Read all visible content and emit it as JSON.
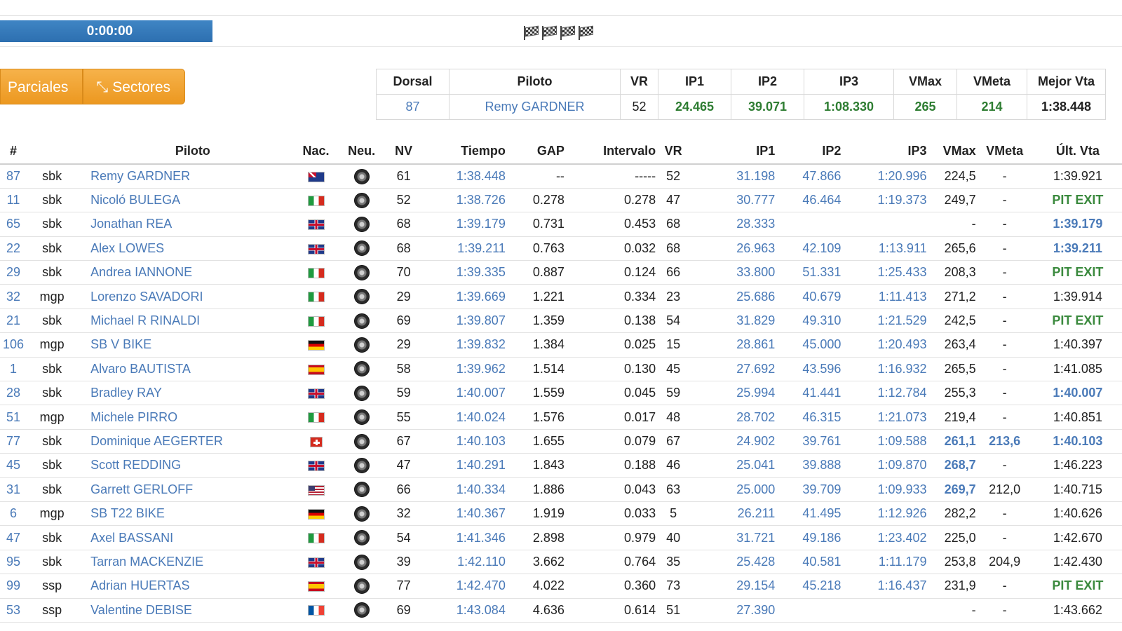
{
  "timer": "0:00:00",
  "buttons": {
    "parciales": "Parciales",
    "sectores": "Sectores"
  },
  "best": {
    "headers": [
      "Dorsal",
      "Piloto",
      "VR",
      "IP1",
      "IP2",
      "IP3",
      "VMax",
      "VMeta",
      "Mejor Vta"
    ],
    "row": [
      "87",
      "Remy GARDNER",
      "52",
      "24.465",
      "39.071",
      "1:08.330",
      "265",
      "214",
      "1:38.448"
    ]
  },
  "table": {
    "headers": [
      "#",
      "",
      "Piloto",
      "Nac.",
      "Neu.",
      "NV",
      "Tiempo",
      "GAP",
      "Intervalo",
      "VR",
      "IP1",
      "IP2",
      "IP3",
      "VMax",
      "VMeta",
      "Últ. Vta"
    ],
    "rows": [
      {
        "num": "87",
        "cls": "sbk",
        "piloto": "Remy GARDNER",
        "nac": "AUS",
        "nv": "61",
        "tiempo": "1:38.448",
        "gap": "--",
        "int": "-----",
        "vr": "52",
        "ip1": "31.198",
        "ip2": "47.866",
        "ip3": "1:20.996",
        "vmax": "224,5",
        "vmeta": "-",
        "ult": "1:39.921"
      },
      {
        "num": "11",
        "cls": "sbk",
        "piloto": "Nicoló BULEGA",
        "nac": "ITA",
        "nv": "52",
        "tiempo": "1:38.726",
        "gap": "0.278",
        "int": "0.278",
        "vr": "47",
        "ip1": "30.777",
        "ip2": "46.464",
        "ip3": "1:19.373",
        "vmax": "249,7",
        "vmeta": "-",
        "ult": "PIT EXIT",
        "ult_style": "green"
      },
      {
        "num": "65",
        "cls": "sbk",
        "piloto": "Jonathan REA",
        "nac": "GBR",
        "nv": "68",
        "tiempo": "1:39.179",
        "gap": "0.731",
        "int": "0.453",
        "vr": "68",
        "ip1": "28.333",
        "ip2": "",
        "ip3": "",
        "vmax": "-",
        "vmeta": "-",
        "ult": "1:39.179",
        "ult_style": "blue"
      },
      {
        "num": "22",
        "cls": "sbk",
        "piloto": "Alex LOWES",
        "nac": "GBR",
        "nv": "68",
        "tiempo": "1:39.211",
        "gap": "0.763",
        "int": "0.032",
        "vr": "68",
        "ip1": "26.963",
        "ip2": "42.109",
        "ip3": "1:13.911",
        "vmax": "265,6",
        "vmeta": "-",
        "ult": "1:39.211",
        "ult_style": "blue"
      },
      {
        "num": "29",
        "cls": "sbk",
        "piloto": "Andrea IANNONE",
        "nac": "ITA",
        "nv": "70",
        "tiempo": "1:39.335",
        "gap": "0.887",
        "int": "0.124",
        "vr": "66",
        "ip1": "33.800",
        "ip2": "51.331",
        "ip3": "1:25.433",
        "vmax": "208,3",
        "vmeta": "-",
        "ult": "PIT EXIT",
        "ult_style": "green"
      },
      {
        "num": "32",
        "cls": "mgp",
        "piloto": "Lorenzo SAVADORI",
        "nac": "ITA",
        "nv": "29",
        "tiempo": "1:39.669",
        "gap": "1.221",
        "int": "0.334",
        "vr": "23",
        "ip1": "25.686",
        "ip2": "40.679",
        "ip3": "1:11.413",
        "vmax": "271,2",
        "vmeta": "-",
        "ult": "1:39.914"
      },
      {
        "num": "21",
        "cls": "sbk",
        "piloto": "Michael R RINALDI",
        "nac": "ITA",
        "nv": "69",
        "tiempo": "1:39.807",
        "gap": "1.359",
        "int": "0.138",
        "vr": "54",
        "ip1": "31.829",
        "ip2": "49.310",
        "ip3": "1:21.529",
        "vmax": "242,5",
        "vmeta": "-",
        "ult": "PIT EXIT",
        "ult_style": "green"
      },
      {
        "num": "106",
        "cls": "mgp",
        "piloto": "SB V BIKE",
        "nac": "DEU",
        "nv": "29",
        "tiempo": "1:39.832",
        "gap": "1.384",
        "int": "0.025",
        "vr": "15",
        "ip1": "28.861",
        "ip2": "45.000",
        "ip3": "1:20.493",
        "vmax": "263,4",
        "vmeta": "-",
        "ult": "1:40.397"
      },
      {
        "num": "1",
        "cls": "sbk",
        "piloto": "Alvaro BAUTISTA",
        "nac": "ESP",
        "nv": "58",
        "tiempo": "1:39.962",
        "gap": "1.514",
        "int": "0.130",
        "vr": "45",
        "ip1": "27.692",
        "ip2": "43.596",
        "ip3": "1:16.932",
        "vmax": "265,5",
        "vmeta": "-",
        "ult": "1:41.085"
      },
      {
        "num": "28",
        "cls": "sbk",
        "piloto": "Bradley RAY",
        "nac": "GBR",
        "nv": "59",
        "tiempo": "1:40.007",
        "gap": "1.559",
        "int": "0.045",
        "vr": "59",
        "ip1": "25.994",
        "ip2": "41.441",
        "ip3": "1:12.784",
        "vmax": "255,3",
        "vmeta": "-",
        "ult": "1:40.007",
        "ult_style": "blue"
      },
      {
        "num": "51",
        "cls": "mgp",
        "piloto": "Michele PIRRO",
        "nac": "ITA",
        "nv": "55",
        "tiempo": "1:40.024",
        "gap": "1.576",
        "int": "0.017",
        "vr": "48",
        "ip1": "28.702",
        "ip2": "46.315",
        "ip3": "1:21.073",
        "vmax": "219,4",
        "vmeta": "-",
        "ult": "1:40.851"
      },
      {
        "num": "77",
        "cls": "sbk",
        "piloto": "Dominique AEGERTER",
        "nac": "CHE",
        "nv": "67",
        "tiempo": "1:40.103",
        "gap": "1.655",
        "int": "0.079",
        "vr": "67",
        "ip1": "24.902",
        "ip2": "39.761",
        "ip3": "1:09.588",
        "vmax": "261,1",
        "vmax_style": "blue",
        "vmeta": "213,6",
        "vmeta_style": "blue",
        "ult": "1:40.103",
        "ult_style": "blue"
      },
      {
        "num": "45",
        "cls": "sbk",
        "piloto": "Scott REDDING",
        "nac": "GBR",
        "nv": "47",
        "tiempo": "1:40.291",
        "gap": "1.843",
        "int": "0.188",
        "vr": "46",
        "ip1": "25.041",
        "ip2": "39.888",
        "ip3": "1:09.870",
        "vmax": "268,7",
        "vmax_style": "blue",
        "vmeta": "-",
        "ult": "1:46.223"
      },
      {
        "num": "31",
        "cls": "sbk",
        "piloto": "Garrett GERLOFF",
        "nac": "USA",
        "nv": "66",
        "tiempo": "1:40.334",
        "gap": "1.886",
        "int": "0.043",
        "vr": "63",
        "ip1": "25.000",
        "ip2": "39.709",
        "ip3": "1:09.933",
        "vmax": "269,7",
        "vmax_style": "blue",
        "vmeta": "212,0",
        "ult": "1:40.715"
      },
      {
        "num": "6",
        "cls": "mgp",
        "piloto": "SB T22 BIKE",
        "nac": "DEU",
        "nv": "32",
        "tiempo": "1:40.367",
        "gap": "1.919",
        "int": "0.033",
        "vr": "5",
        "ip1": "26.211",
        "ip2": "41.495",
        "ip3": "1:12.926",
        "vmax": "282,2",
        "vmeta": "-",
        "ult": "1:40.626"
      },
      {
        "num": "47",
        "cls": "sbk",
        "piloto": "Axel BASSANI",
        "nac": "ITA",
        "nv": "54",
        "tiempo": "1:41.346",
        "gap": "2.898",
        "int": "0.979",
        "vr": "40",
        "ip1": "31.721",
        "ip2": "49.186",
        "ip3": "1:23.402",
        "vmax": "225,0",
        "vmeta": "-",
        "ult": "1:42.670"
      },
      {
        "num": "95",
        "cls": "sbk",
        "piloto": "Tarran MACKENZIE",
        "nac": "GBR",
        "nv": "39",
        "tiempo": "1:42.110",
        "gap": "3.662",
        "int": "0.764",
        "vr": "35",
        "ip1": "25.428",
        "ip2": "40.581",
        "ip3": "1:11.179",
        "vmax": "253,8",
        "vmeta": "204,9",
        "ult": "1:42.430"
      },
      {
        "num": "99",
        "cls": "ssp",
        "piloto": "Adrian HUERTAS",
        "nac": "ESP",
        "nv": "77",
        "tiempo": "1:42.470",
        "gap": "4.022",
        "int": "0.360",
        "vr": "73",
        "ip1": "29.154",
        "ip2": "45.218",
        "ip3": "1:16.437",
        "vmax": "231,9",
        "vmeta": "-",
        "ult": "PIT EXIT",
        "ult_style": "green"
      },
      {
        "num": "53",
        "cls": "ssp",
        "piloto": "Valentine DEBISE",
        "nac": "FRA",
        "nv": "69",
        "tiempo": "1:43.084",
        "gap": "4.636",
        "int": "0.614",
        "vr": "51",
        "ip1": "27.390",
        "ip2": "",
        "ip3": "",
        "vmax": "-",
        "vmeta": "-",
        "ult": "1:43.662"
      }
    ]
  }
}
